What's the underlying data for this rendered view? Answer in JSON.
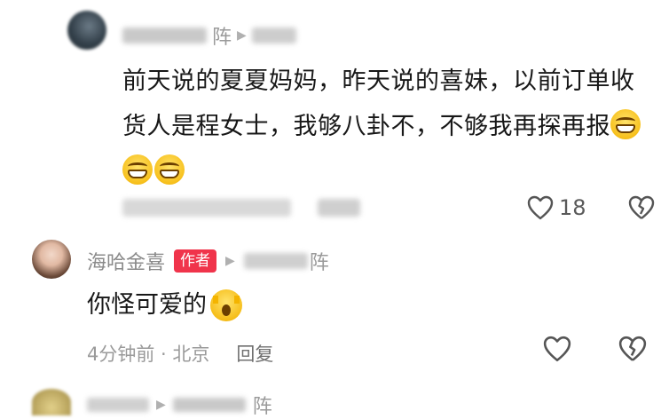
{
  "comment1": {
    "user_tail": "阵",
    "text": "前天说的夏夏妈妈，昨天说的喜妹，以前订单收货人是程女士，我够八卦不，不够我再探再报",
    "like_count": "18"
  },
  "comment2": {
    "username": "海哈金喜",
    "author_badge": "作者",
    "reply_target_tail": "阵",
    "text": "你怪可爱的",
    "time": "4分钟前",
    "location": "北京",
    "reply_label": "回复"
  },
  "comment3": {
    "reply_target_tail": "阵"
  },
  "icons": {
    "like": "heart-outline-icon",
    "dislike": "broken-heart-icon",
    "arrow": "play-arrow-icon",
    "emoji1": "grinning-face-icon",
    "emoji2": "shocked-face-icon"
  }
}
